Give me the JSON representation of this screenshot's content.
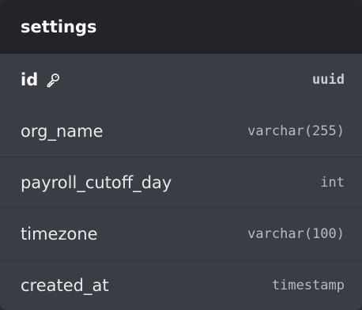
{
  "table": {
    "name": "settings",
    "columns": [
      {
        "name": "id",
        "type": "uuid",
        "primary_key": true,
        "icon": "key-icon"
      },
      {
        "name": "org_name",
        "type": "varchar(255)",
        "primary_key": false
      },
      {
        "name": "payroll_cutoff_day",
        "type": "int",
        "primary_key": false
      },
      {
        "name": "timezone",
        "type": "varchar(100)",
        "primary_key": false
      },
      {
        "name": "created_at",
        "type": "timestamp",
        "primary_key": false
      }
    ]
  },
  "colors": {
    "header_bg": "#22242a",
    "card_bg": "#3b3d45",
    "text": "#e8e9ec",
    "type_text": "#b9bbc2"
  }
}
